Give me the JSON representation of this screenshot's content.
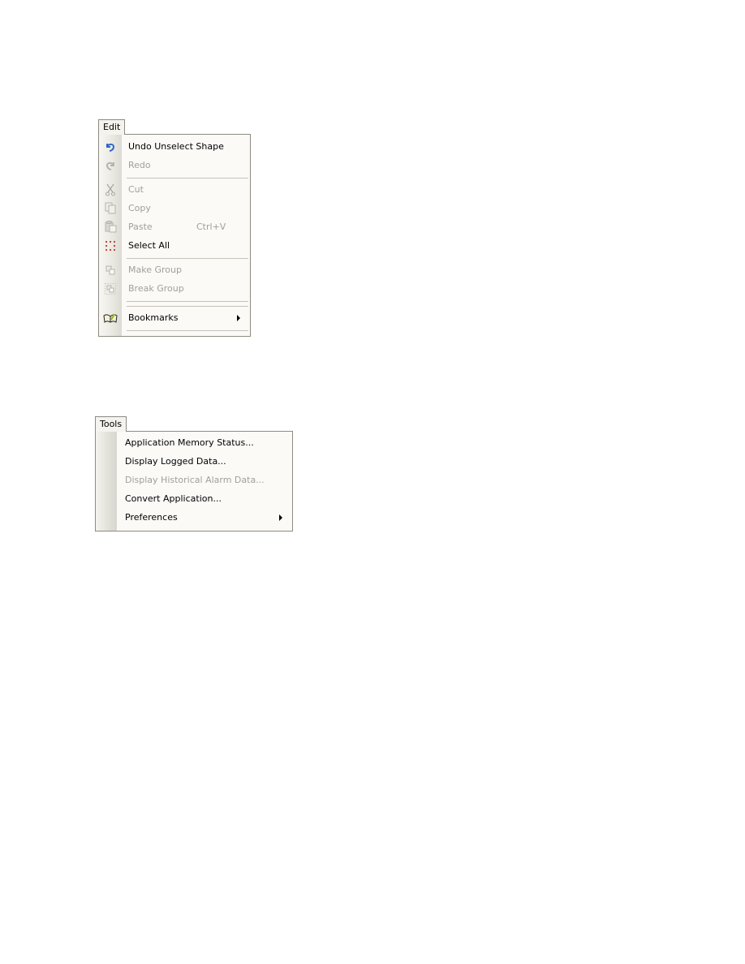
{
  "edit_menu": {
    "title": "Edit",
    "items": [
      {
        "label": "Undo Unselect Shape",
        "icon": "undo-icon",
        "enabled": true
      },
      {
        "label": "Redo",
        "icon": "redo-icon",
        "enabled": false
      },
      {
        "label": "Cut",
        "icon": "cut-icon",
        "enabled": false
      },
      {
        "label": "Copy",
        "icon": "copy-icon",
        "enabled": false
      },
      {
        "label": "Paste",
        "shortcut": "Ctrl+V",
        "icon": "paste-icon",
        "enabled": false
      },
      {
        "label": "Select All",
        "icon": "select-all-icon",
        "enabled": true
      },
      {
        "label": "Make Group",
        "icon": "make-group-icon",
        "enabled": false
      },
      {
        "label": "Break Group",
        "icon": "break-group-icon",
        "enabled": false
      },
      {
        "label": "Bookmarks",
        "icon": "bookmarks-icon",
        "enabled": true,
        "submenu": true
      }
    ]
  },
  "tools_menu": {
    "title": "Tools",
    "items": [
      {
        "label": "Application Memory Status...",
        "enabled": true
      },
      {
        "label": "Display Logged Data...",
        "enabled": true
      },
      {
        "label": "Display Historical Alarm Data...",
        "enabled": false
      },
      {
        "label": "Convert Application...",
        "enabled": true
      },
      {
        "label": "Preferences",
        "enabled": true,
        "submenu": true
      }
    ]
  }
}
